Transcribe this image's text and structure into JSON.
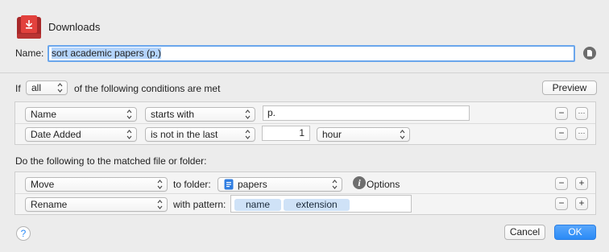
{
  "header": {
    "title": "Downloads",
    "name_label": "Name:",
    "name_value": "sort academic papers (p.)"
  },
  "conditions": {
    "if_label": "If",
    "match_value": "all",
    "suffix": "of the following conditions are met",
    "preview_label": "Preview",
    "rows": [
      {
        "attribute": "Name",
        "operator": "starts with",
        "value": "p."
      },
      {
        "attribute": "Date Added",
        "operator": "is not in the last",
        "number": "1",
        "unit": "hour"
      }
    ]
  },
  "actions": {
    "heading": "Do the following to the matched file or folder:",
    "rows": [
      {
        "action": "Move",
        "to_label": "to folder:",
        "folder": "papers",
        "options_label": "Options"
      },
      {
        "action": "Rename",
        "pattern_label": "with pattern:",
        "tokens": [
          "name",
          "extension"
        ]
      }
    ]
  },
  "footer": {
    "help": "?",
    "cancel_label": "Cancel",
    "ok_label": "OK"
  },
  "buttons": {
    "remove": "−",
    "more": "···",
    "add": "+"
  },
  "colors": {
    "accent": "#2b8bf6",
    "app_icon": "#e2413d",
    "token_bg": "#cfe2f7"
  }
}
